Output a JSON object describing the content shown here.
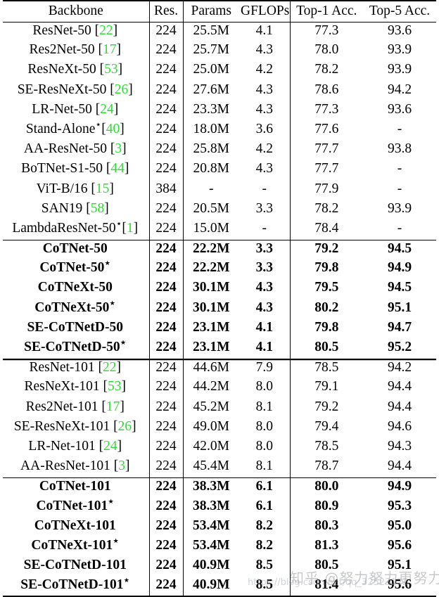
{
  "table": {
    "columns": [
      {
        "key": "backbone",
        "label": "Backbone"
      },
      {
        "key": "res",
        "label": "Res."
      },
      {
        "key": "params",
        "label": "Params"
      },
      {
        "key": "gflops",
        "label": "GFLOPs"
      },
      {
        "key": "top1",
        "label": "Top-1 Acc."
      },
      {
        "key": "top5",
        "label": "Top-5 Acc."
      }
    ],
    "citation_color": "#2fdc35",
    "groups": [
      {
        "id": "group-50-baselines",
        "bold": false,
        "rows": [
          {
            "name": "ResNet-50",
            "star": false,
            "cite": "22",
            "res": "224",
            "params": "25.5M",
            "gflops": "4.1",
            "top1": "77.3",
            "top5": "93.6"
          },
          {
            "name": "Res2Net-50",
            "star": false,
            "cite": "17",
            "res": "224",
            "params": "25.7M",
            "gflops": "4.3",
            "top1": "78.0",
            "top5": "93.9"
          },
          {
            "name": "ResNeXt-50",
            "star": false,
            "cite": "53",
            "res": "224",
            "params": "25.0M",
            "gflops": "4.2",
            "top1": "78.2",
            "top5": "93.9"
          },
          {
            "name": "SE-ResNeXt-50",
            "star": false,
            "cite": "26",
            "res": "224",
            "params": "27.6M",
            "gflops": "4.3",
            "top1": "78.6",
            "top5": "94.2"
          },
          {
            "name": "LR-Net-50",
            "star": false,
            "cite": "24",
            "res": "224",
            "params": "23.3M",
            "gflops": "4.3",
            "top1": "77.3",
            "top5": "93.6"
          },
          {
            "name": "Stand-Alone",
            "star": true,
            "cite": "40",
            "res": "224",
            "params": "18.0M",
            "gflops": "3.6",
            "top1": "77.6",
            "top5": "-"
          },
          {
            "name": "AA-ResNet-50",
            "star": false,
            "cite": "3",
            "res": "224",
            "params": "25.8M",
            "gflops": "4.2",
            "top1": "77.7",
            "top5": "93.8"
          },
          {
            "name": "BoTNet-S1-50",
            "star": false,
            "cite": "44",
            "res": "224",
            "params": "20.8M",
            "gflops": "4.3",
            "top1": "77.7",
            "top5": "-"
          },
          {
            "name": "ViT-B/16",
            "star": false,
            "cite": "15",
            "res": "384",
            "params": "-",
            "gflops": "-",
            "top1": "77.9",
            "top5": "-"
          },
          {
            "name": "SAN19",
            "star": false,
            "cite": "58",
            "res": "224",
            "params": "20.5M",
            "gflops": "3.3",
            "top1": "78.2",
            "top5": "93.9"
          },
          {
            "name": "LambdaResNet-50",
            "star": true,
            "cite": "1",
            "res": "224",
            "params": "15.0M",
            "gflops": "-",
            "top1": "78.4",
            "top5": "-"
          }
        ]
      },
      {
        "id": "group-50-ours",
        "bold": true,
        "rows": [
          {
            "name": "CoTNet-50",
            "star": false,
            "cite": "",
            "res": "224",
            "params": "22.2M",
            "gflops": "3.3",
            "top1": "79.2",
            "top5": "94.5"
          },
          {
            "name": "CoTNet-50",
            "star": true,
            "cite": "",
            "res": "224",
            "params": "22.2M",
            "gflops": "3.3",
            "top1": "79.8",
            "top5": "94.9"
          },
          {
            "name": "CoTNeXt-50",
            "star": false,
            "cite": "",
            "res": "224",
            "params": "30.1M",
            "gflops": "4.3",
            "top1": "79.5",
            "top5": "94.5"
          },
          {
            "name": "CoTNeXt-50",
            "star": true,
            "cite": "",
            "res": "224",
            "params": "30.1M",
            "gflops": "4.3",
            "top1": "80.2",
            "top5": "95.1"
          },
          {
            "name": "SE-CoTNetD-50",
            "star": false,
            "cite": "",
            "res": "224",
            "params": "23.1M",
            "gflops": "4.1",
            "top1": "79.8",
            "top5": "94.7"
          },
          {
            "name": "SE-CoTNetD-50",
            "star": true,
            "cite": "",
            "res": "224",
            "params": "23.1M",
            "gflops": "4.1",
            "top1": "80.5",
            "top5": "95.2"
          }
        ]
      },
      {
        "id": "group-101-baselines",
        "bold": false,
        "rows": [
          {
            "name": "ResNet-101",
            "star": false,
            "cite": "22",
            "res": "224",
            "params": "44.6M",
            "gflops": "7.9",
            "top1": "78.5",
            "top5": "94.2"
          },
          {
            "name": "ResNeXt-101",
            "star": false,
            "cite": "53",
            "res": "224",
            "params": "44.2M",
            "gflops": "8.0",
            "top1": "79.1",
            "top5": "94.4"
          },
          {
            "name": "Res2Net-101",
            "star": false,
            "cite": "17",
            "res": "224",
            "params": "45.2M",
            "gflops": "8.1",
            "top1": "79.2",
            "top5": "94.4"
          },
          {
            "name": "SE-ResNeXt-101",
            "star": false,
            "cite": "26",
            "res": "224",
            "params": "49.0M",
            "gflops": "8.0",
            "top1": "79.4",
            "top5": "94.6"
          },
          {
            "name": "LR-Net-101",
            "star": false,
            "cite": "24",
            "res": "224",
            "params": "42.0M",
            "gflops": "8.0",
            "top1": "78.5",
            "top5": "94.3"
          },
          {
            "name": "AA-ResNet-101",
            "star": false,
            "cite": "3",
            "res": "224",
            "params": "45.4M",
            "gflops": "8.1",
            "top1": "78.7",
            "top5": "94.4"
          }
        ]
      },
      {
        "id": "group-101-ours",
        "bold": true,
        "rows": [
          {
            "name": "CoTNet-101",
            "star": false,
            "cite": "",
            "res": "224",
            "params": "38.3M",
            "gflops": "6.1",
            "top1": "80.0",
            "top5": "94.9"
          },
          {
            "name": "CoTNet-101",
            "star": true,
            "cite": "",
            "res": "224",
            "params": "38.3M",
            "gflops": "6.1",
            "top1": "80.9",
            "top5": "95.3"
          },
          {
            "name": "CoTNeXt-101",
            "star": false,
            "cite": "",
            "res": "224",
            "params": "53.4M",
            "gflops": "8.2",
            "top1": "80.3",
            "top5": "95.0"
          },
          {
            "name": "CoTNeXt-101",
            "star": true,
            "cite": "",
            "res": "224",
            "params": "53.4M",
            "gflops": "8.2",
            "top1": "81.3",
            "top5": "95.6"
          },
          {
            "name": "SE-CoTNetD-101",
            "star": false,
            "cite": "",
            "res": "224",
            "params": "40.9M",
            "gflops": "8.5",
            "top1": "80.5",
            "top5": "95.1"
          },
          {
            "name": "SE-CoTNetD-101",
            "star": true,
            "cite": "",
            "res": "224",
            "params": "40.9M",
            "gflops": "8.5",
            "top1": "81.4",
            "top5": "95.6"
          }
        ]
      }
    ]
  },
  "watermark": {
    "cn_text": "知乎 @努力努力更努力",
    "url_text": "https://blog.csdn.net/qq_32523122"
  }
}
